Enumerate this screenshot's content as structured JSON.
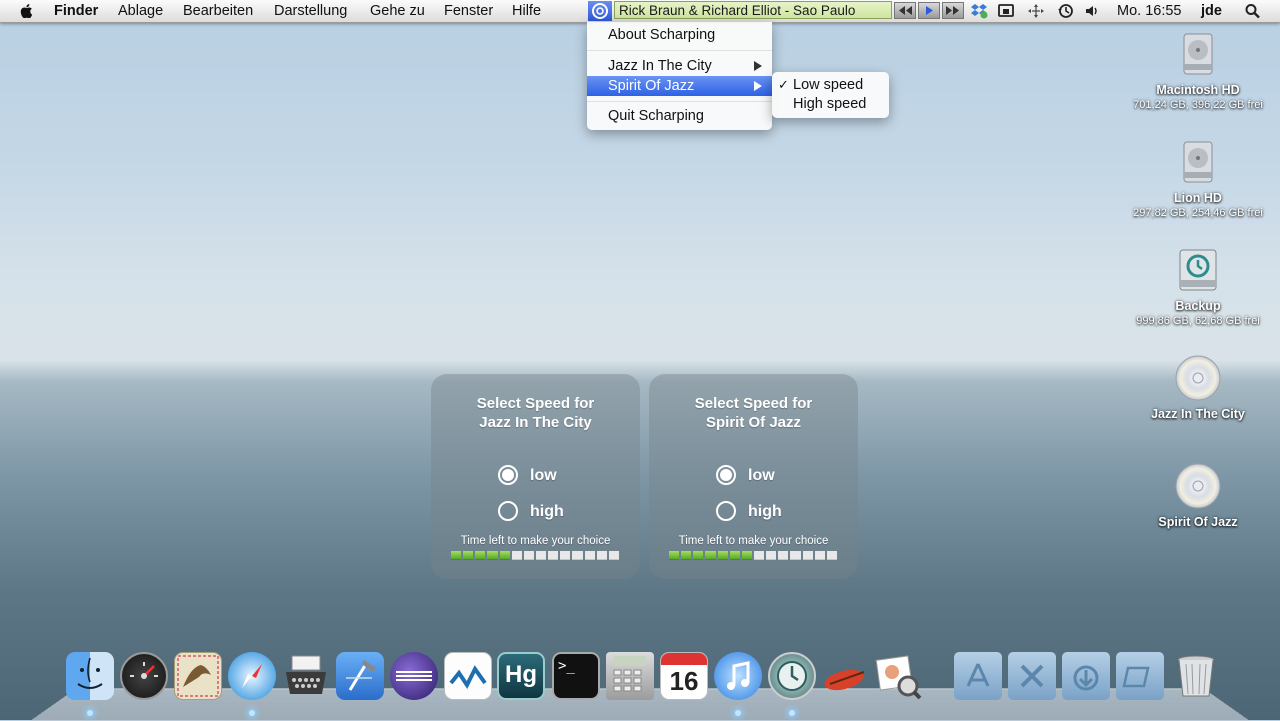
{
  "menubar": {
    "app": "Finder",
    "items": [
      "Ablage",
      "Bearbeiten",
      "Darstellung",
      "Gehe zu",
      "Fenster",
      "Hilfe"
    ],
    "now_playing": "Rick Braun & Richard Elliot - Sao Paulo",
    "clock": "Mo. 16:55",
    "user": "jde"
  },
  "menu": {
    "about": "About Scharping",
    "jazz": "Jazz In The City",
    "spirit": "Spirit Of Jazz",
    "quit": "Quit Scharping"
  },
  "submenu": {
    "low": "Low speed",
    "high": "High speed",
    "checked": "low"
  },
  "desktop": [
    {
      "name": "Macintosh HD",
      "sub": "701,24 GB, 396,22 GB frei",
      "icon": "hard-drive-icon"
    },
    {
      "name": "Lion HD",
      "sub": "297,82 GB, 254,46 GB frei",
      "icon": "hard-drive-icon"
    },
    {
      "name": "Backup",
      "sub": "999,86 GB, 62,68 GB frei",
      "icon": "time-machine-drive-icon"
    },
    {
      "name": "Jazz In The City",
      "sub": "",
      "icon": "cd-icon"
    },
    {
      "name": "Spirit Of Jazz",
      "sub": "",
      "icon": "cd-icon"
    }
  ],
  "panels": [
    {
      "title1": "Select Speed for",
      "title2": "Jazz In The City",
      "low": "low",
      "high": "high",
      "selected": "low",
      "time_text": "Time left to make your choice",
      "progress_segments_filled": 5,
      "progress_segments_total": 14
    },
    {
      "title1": "Select Speed for",
      "title2": "Spirit Of Jazz",
      "low": "low",
      "high": "high",
      "selected": "low",
      "time_text": "Time left to make your choice",
      "progress_segments_filled": 7,
      "progress_segments_total": 14
    }
  ],
  "calendar_day": "16",
  "hg_label": "Hg",
  "terminal_prompt": ">_",
  "dock_icons": [
    "finder",
    "dashboard",
    "mail",
    "safari",
    "typewriter",
    "xcode",
    "eclipse",
    "vectorworks",
    "mercurial",
    "terminal",
    "calculator",
    "ical",
    "itunes",
    "time-machine",
    "guitar",
    "preview",
    "applications-folder",
    "utilities-folder",
    "downloads-folder",
    "documents-folder",
    "trash"
  ]
}
